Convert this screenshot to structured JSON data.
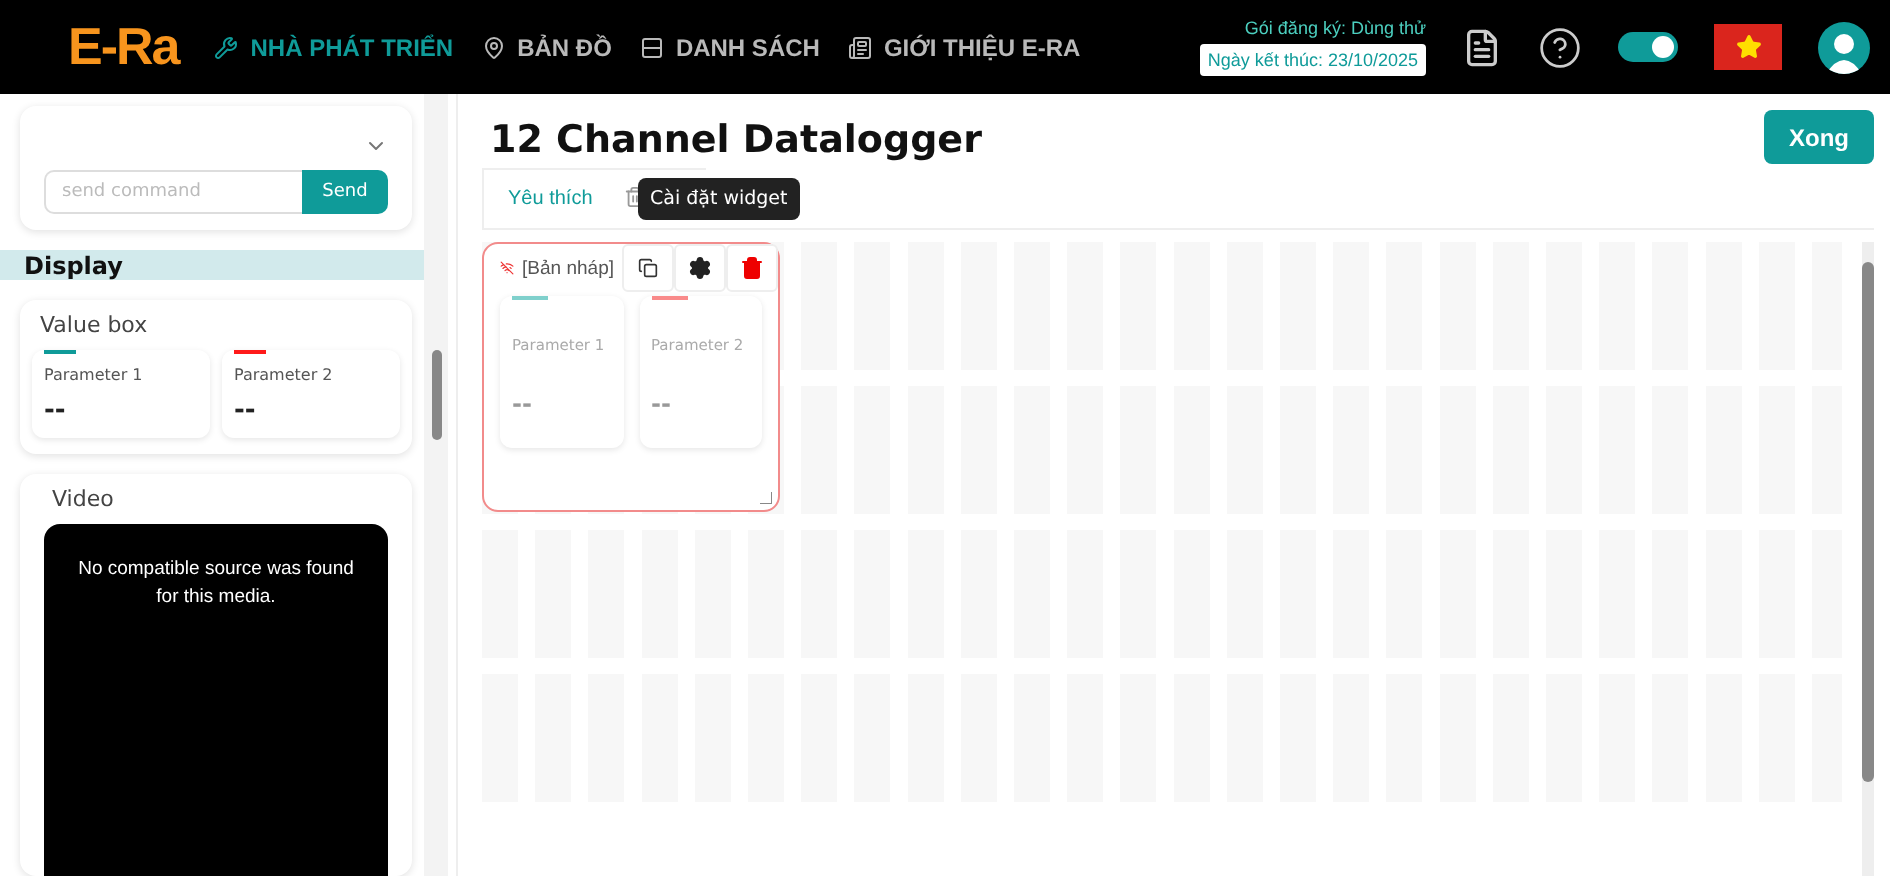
{
  "header": {
    "logo": "E-Ra",
    "nav": [
      {
        "label": "NHÀ PHÁT TRIỂN",
        "selected": true
      },
      {
        "label": "BẢN ĐỒ",
        "selected": false
      },
      {
        "label": "DANH SÁCH",
        "selected": false
      },
      {
        "label": "GIỚI THIỆU E-RA",
        "selected": false
      }
    ],
    "plan": "Gói đăng ký: Dùng thử",
    "expiry": "Ngày kết thúc: 23/10/2025",
    "dark_mode_on": true
  },
  "sidebar": {
    "command": {
      "placeholder": "send command",
      "button": "Send"
    },
    "section": "Display",
    "value_box": {
      "title": "Value box",
      "params": [
        {
          "name": "Parameter 1",
          "value": "--",
          "color": "#0f9b99"
        },
        {
          "name": "Parameter 2",
          "value": "--",
          "color": "#ff1a1a"
        }
      ]
    },
    "video": {
      "title": "Video",
      "message": "No compatible source was found for this media."
    }
  },
  "main": {
    "title": "12 Channel Datalogger",
    "done_button": "Xong",
    "tabs": [
      {
        "label": "Yêu thích",
        "selected": true
      },
      {
        "kind": "icon",
        "selected": false
      }
    ],
    "widget": {
      "title": "[Bản nháp]",
      "tooltip": "Cài đặt widget",
      "params": [
        {
          "name": "Parameter 1",
          "value": "--",
          "color": "#7fd0cc"
        },
        {
          "name": "Parameter 2",
          "value": "--",
          "color": "#f98a8a"
        }
      ]
    }
  }
}
